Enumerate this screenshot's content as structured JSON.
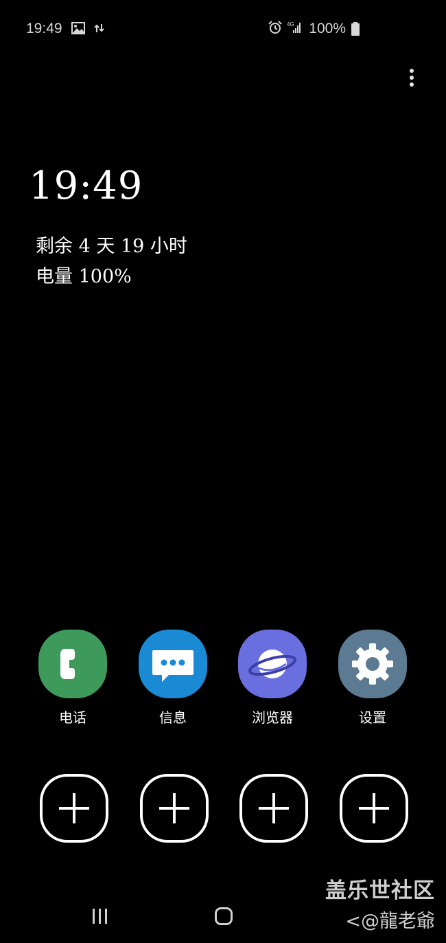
{
  "status_bar": {
    "time": "19:49",
    "battery_percent": "100%",
    "icons": [
      "gallery-icon",
      "data-transfer-icon",
      "alarm-icon",
      "4g-signal-icon",
      "battery-icon"
    ]
  },
  "overflow_menu": {
    "icon": "more-vert-icon"
  },
  "aod": {
    "clock": "19:49",
    "remaining": "剩余 4 天 19 小时",
    "battery": "电量 100%"
  },
  "dock": {
    "apps": [
      {
        "label": "电话",
        "icon": "phone-icon",
        "color": "#3d9a5b"
      },
      {
        "label": "信息",
        "icon": "message-icon",
        "color": "#1a8ad4"
      },
      {
        "label": "浏览器",
        "icon": "planet-icon",
        "color": "#6a6fe0"
      },
      {
        "label": "设置",
        "icon": "gear-icon",
        "color": "#5c7a91"
      }
    ]
  },
  "add_slots": {
    "icon": "plus-icon",
    "count": 4
  },
  "nav": {
    "recents_icon": "recents-icon",
    "home_icon": "home-icon"
  },
  "watermark": {
    "line1": "盖乐世社区",
    "line2": "<@龍老爺"
  }
}
